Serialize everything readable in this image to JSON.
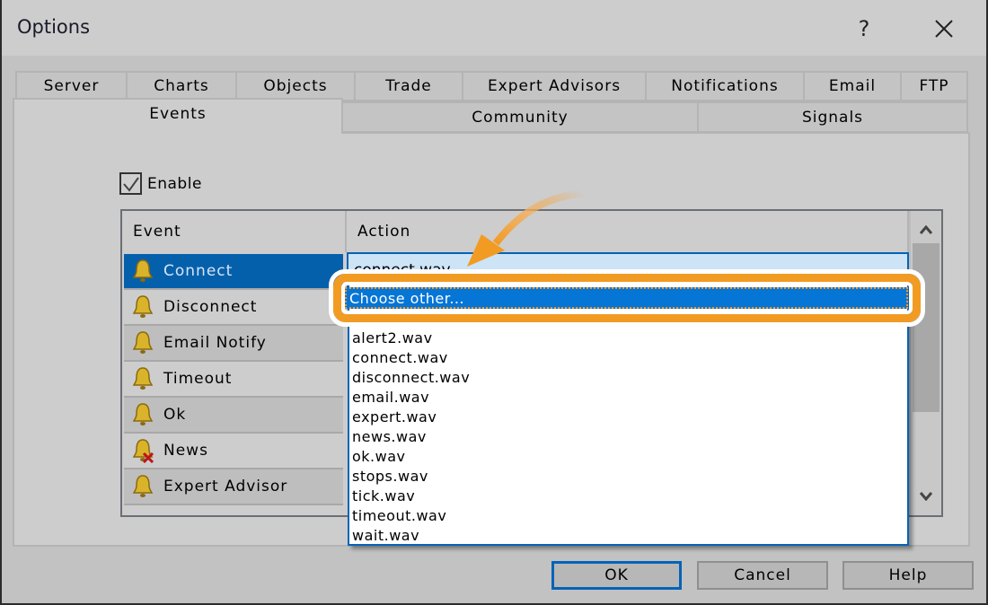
{
  "window": {
    "title": "Options",
    "help_glyph": "?",
    "close_glyph": "✕"
  },
  "tabs": {
    "row1": [
      {
        "label": "Server"
      },
      {
        "label": "Charts"
      },
      {
        "label": "Objects"
      },
      {
        "label": "Trade"
      },
      {
        "label": "Expert Advisors"
      },
      {
        "label": "Notifications"
      },
      {
        "label": "Email"
      },
      {
        "label": "FTP"
      }
    ],
    "row2": [
      {
        "label": "Events",
        "active": true
      },
      {
        "label": "Community"
      },
      {
        "label": "Signals"
      }
    ]
  },
  "enable": {
    "label": "Enable",
    "checked": true
  },
  "table": {
    "headers": {
      "event": "Event",
      "action": "Action"
    },
    "rows": [
      {
        "label": "Connect",
        "icon": "bell-icon",
        "selected": true
      },
      {
        "label": "Disconnect",
        "icon": "bell-icon"
      },
      {
        "label": "Email Notify",
        "icon": "bell-icon"
      },
      {
        "label": "Timeout",
        "icon": "bell-icon"
      },
      {
        "label": "Ok",
        "icon": "bell-icon"
      },
      {
        "label": "News",
        "icon": "bell-disabled-icon"
      },
      {
        "label": "Expert Advisor",
        "icon": "bell-icon"
      }
    ],
    "combo_value": "connect.wav"
  },
  "dropdown": {
    "highlighted": "Choose other...",
    "items": [
      "alert2.wav",
      "connect.wav",
      "disconnect.wav",
      "email.wav",
      "expert.wav",
      "news.wav",
      "ok.wav",
      "stops.wav",
      "tick.wav",
      "timeout.wav",
      "wait.wav"
    ]
  },
  "buttons": {
    "ok": "OK",
    "cancel": "Cancel",
    "help": "Help"
  },
  "colors": {
    "accent": "#0563b8",
    "selection": "#0575d6",
    "callout": "#f29b23"
  }
}
